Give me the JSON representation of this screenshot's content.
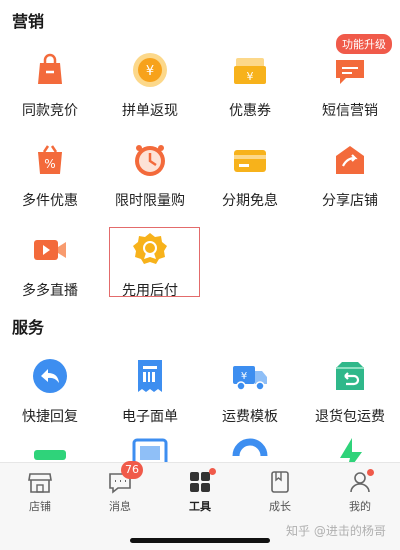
{
  "sections": {
    "marketing_title": "营销",
    "service_title": "服务"
  },
  "marketing": {
    "upgrade_badge": "功能升级",
    "items": [
      {
        "label": "同款竞价",
        "icon": "shopping-bag-icon",
        "color": "#f36a3b"
      },
      {
        "label": "拼单返现",
        "icon": "yen-coin-icon",
        "color": "#f7a21b"
      },
      {
        "label": "优惠券",
        "icon": "coupon-ticket-icon",
        "color": "#f7b21b"
      },
      {
        "label": "短信营销",
        "icon": "sms-message-icon",
        "color": "#f36a3b"
      },
      {
        "label": "多件优惠",
        "icon": "discount-bag-icon",
        "color": "#f36a3b"
      },
      {
        "label": "限时限量购",
        "icon": "alarm-clock-icon",
        "color": "#f36a3b"
      },
      {
        "label": "分期免息",
        "icon": "credit-card-icon",
        "color": "#f7b21b"
      },
      {
        "label": "分享店铺",
        "icon": "share-store-icon",
        "color": "#f36a3b"
      },
      {
        "label": "多多直播",
        "icon": "live-video-icon",
        "color": "#f36a3b"
      },
      {
        "label": "先用后付",
        "icon": "badge-check-icon",
        "color": "#f7b21b"
      }
    ]
  },
  "services": {
    "items": [
      {
        "label": "快捷回复",
        "icon": "reply-icon",
        "color": "#3d8ef0"
      },
      {
        "label": "电子面单",
        "icon": "e-waybill-icon",
        "color": "#3d8ef0"
      },
      {
        "label": "运费模板",
        "icon": "delivery-truck-icon",
        "color": "#3d8ef0"
      },
      {
        "label": "退货包运费",
        "icon": "return-package-icon",
        "color": "#2fb88a"
      }
    ]
  },
  "tabbar": {
    "tabs": [
      {
        "label": "店铺",
        "icon": "store-icon"
      },
      {
        "label": "消息",
        "icon": "message-icon",
        "badge": "76"
      },
      {
        "label": "工具",
        "icon": "tools-grid-icon",
        "active": true
      },
      {
        "label": "成长",
        "icon": "book-icon"
      },
      {
        "label": "我的",
        "icon": "profile-icon"
      }
    ]
  },
  "watermark": "知乎 @进击的杨哥"
}
